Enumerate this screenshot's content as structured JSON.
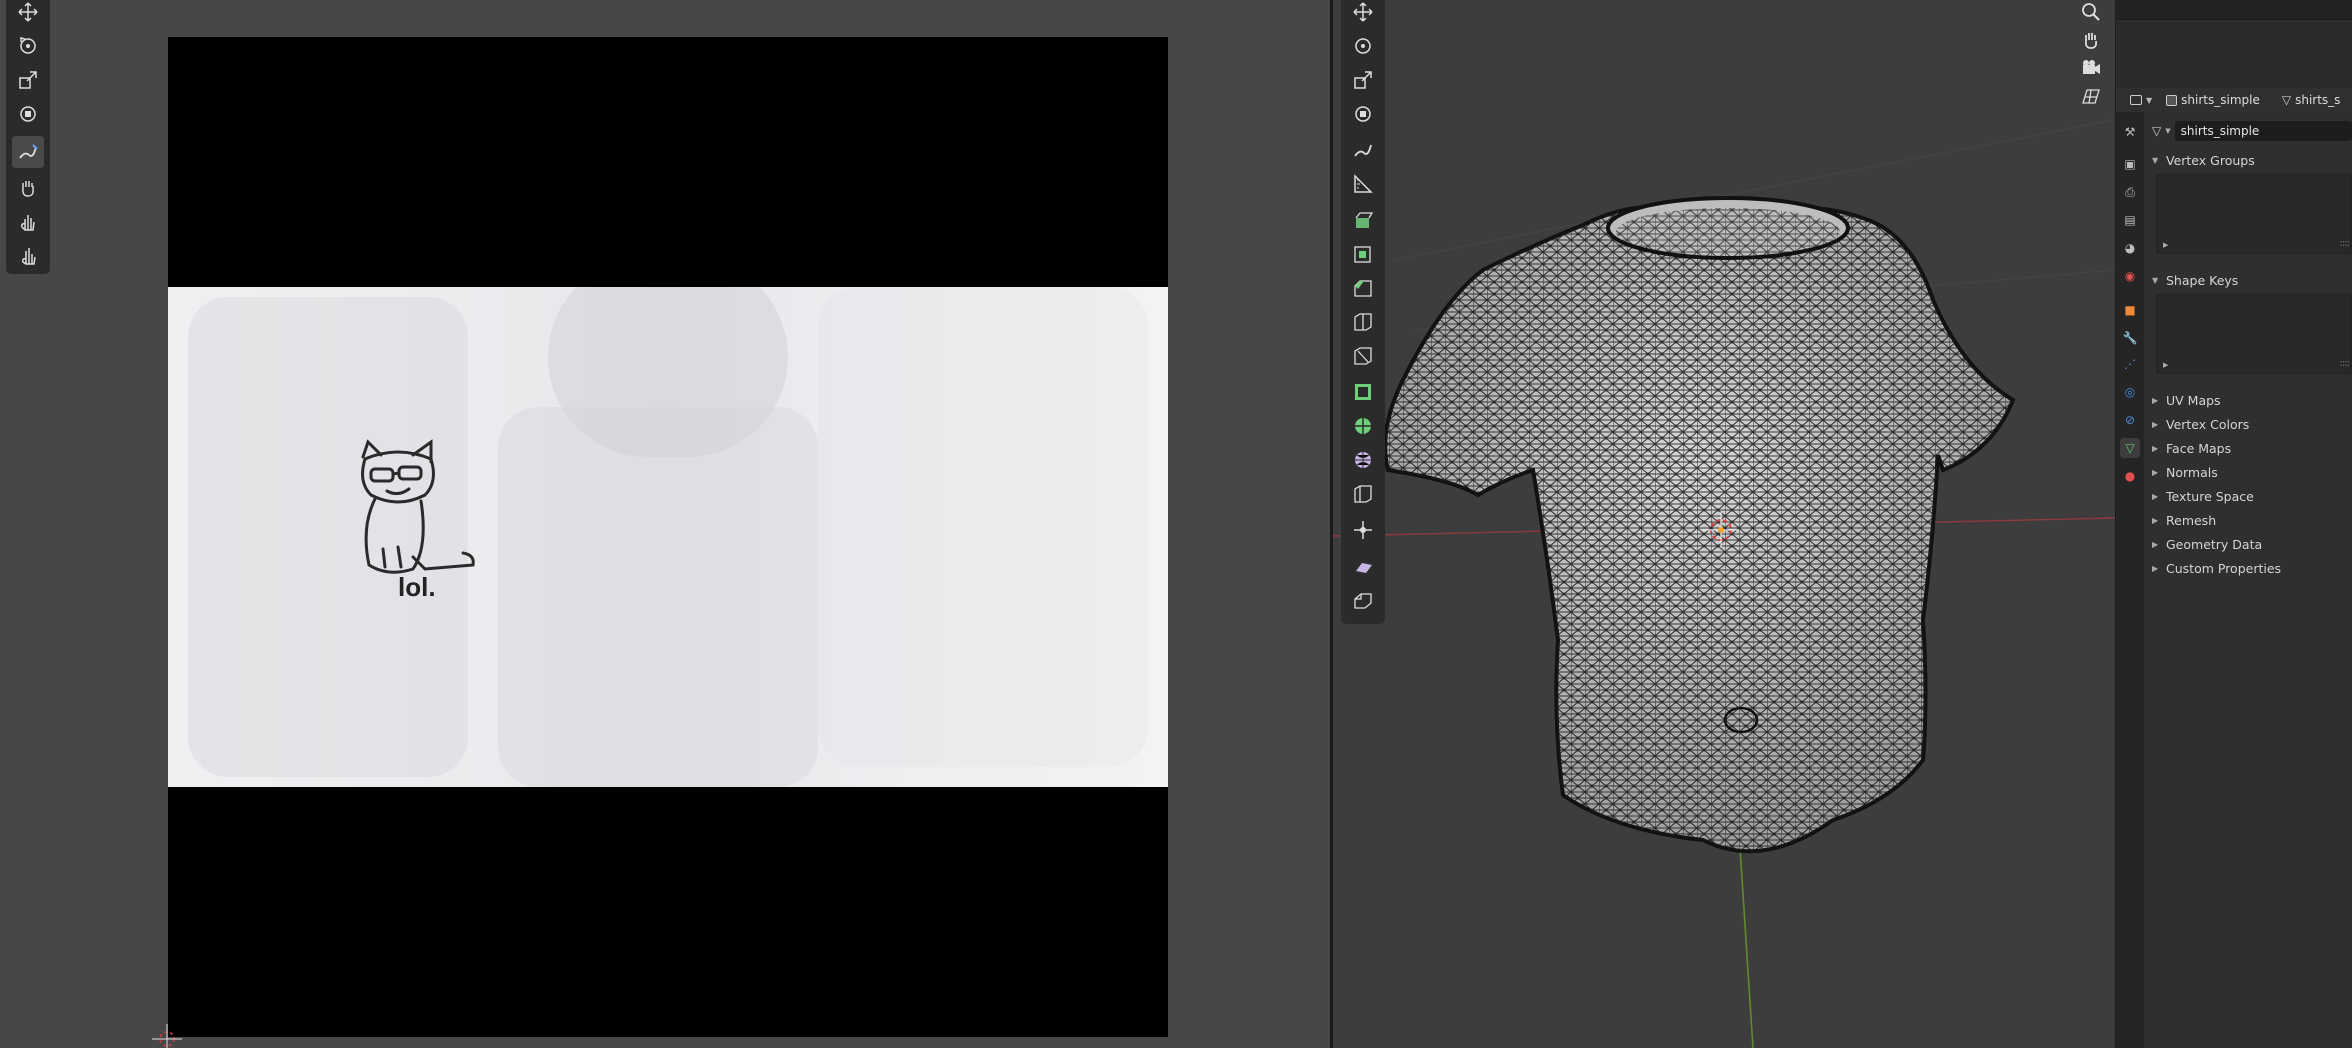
{
  "image_editor": {
    "texture_text": "lol.",
    "tools": [
      {
        "name": "move-icon"
      },
      {
        "name": "rotate-icon"
      },
      {
        "name": "scale-icon"
      },
      {
        "name": "transform-icon"
      },
      {
        "name": "annotate-icon",
        "active": true
      },
      {
        "name": "grab-icon"
      },
      {
        "name": "relax-icon"
      },
      {
        "name": "pinch-icon"
      }
    ]
  },
  "viewport": {
    "tools": [
      "move-icon",
      "rotate-icon",
      "scale-icon",
      "transform-icon",
      "annotate-icon",
      "measure-icon",
      "extrude-icon",
      "inset-icon",
      "bevel-icon",
      "loop-cut-icon",
      "knife-icon",
      "poly-build-icon",
      "spin-icon",
      "smooth-icon",
      "edge-slide-icon",
      "shrink-fatten-icon",
      "shear-icon",
      "rip-icon"
    ],
    "nav": [
      "zoom-icon",
      "pan-hand-icon",
      "camera-icon",
      "grid-icon"
    ]
  },
  "properties": {
    "object_name": "shirts_simple",
    "mesh_name_short": "shirts_s",
    "mesh_name": "shirts_simple",
    "panels": {
      "vertex_groups": "Vertex Groups",
      "shape_keys": "Shape Keys",
      "uv_maps": "UV Maps",
      "vertex_colors": "Vertex Colors",
      "face_maps": "Face Maps",
      "normals": "Normals",
      "texture_space": "Texture Space",
      "remesh": "Remesh",
      "geometry_data": "Geometry Data",
      "custom_properties": "Custom Properties"
    },
    "tab_colors": {
      "tool": "#bdbdbd",
      "render": "#bdbdbd",
      "output": "#bdbdbd",
      "view_layer": "#bdbdbd",
      "scene": "#bdbdbd",
      "world": "#e05050",
      "object": "#f08a3a",
      "modifiers": "#4d8fe0",
      "particles": "#4d8fe0",
      "physics": "#4d8fe0",
      "constraints": "#4d8fe0",
      "data": "#5fd07a",
      "material": "#e05050"
    }
  }
}
